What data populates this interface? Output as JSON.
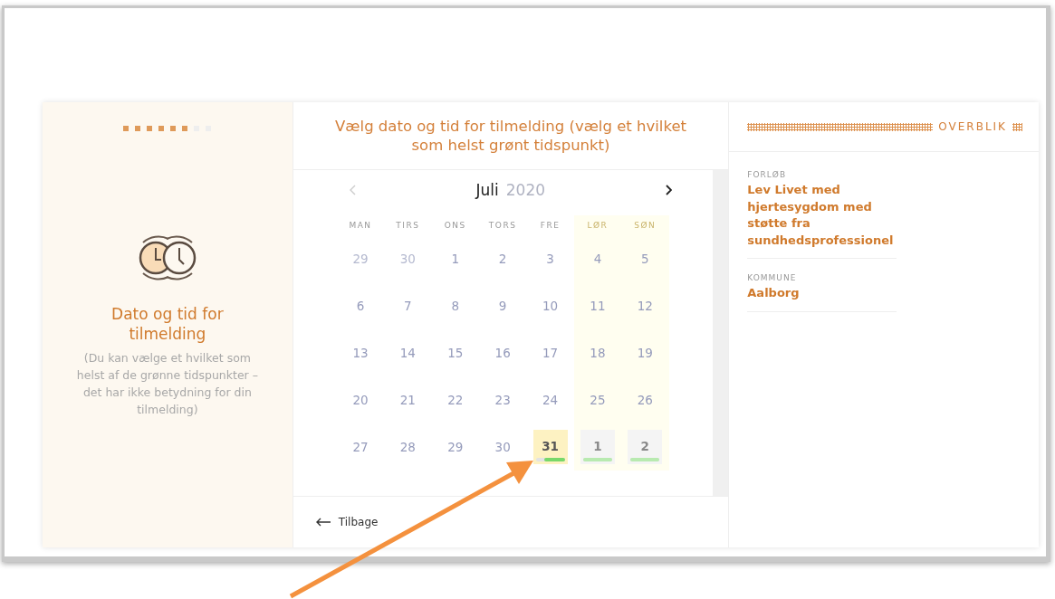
{
  "progress": {
    "steps": [
      {
        "done": true
      },
      {
        "done": true
      },
      {
        "done": true
      },
      {
        "done": true
      },
      {
        "done": true
      },
      {
        "done": true
      },
      {
        "done": false
      },
      {
        "done": false
      }
    ]
  },
  "step": {
    "title": "Dato og tid for tilmelding",
    "description": "(Du kan vælge et hvilket som helst af de grønne tidspunkter – det har ikke betydning for din tilmelding)"
  },
  "calendar": {
    "title": "Vælg dato og tid for tilmelding (vælg et hvilket som helst grønt tidspunkt)",
    "prev_disabled": true,
    "month": "Juli",
    "year": "2020",
    "weekdays": [
      {
        "label": "MAN",
        "weekend": false
      },
      {
        "label": "TIRS",
        "weekend": false
      },
      {
        "label": "ONS",
        "weekend": false
      },
      {
        "label": "TORS",
        "weekend": false
      },
      {
        "label": "FRE",
        "weekend": false
      },
      {
        "label": "LØR",
        "weekend": true
      },
      {
        "label": "SØN",
        "weekend": true
      }
    ],
    "weeks": [
      [
        {
          "label": "29",
          "kind": "other"
        },
        {
          "label": "30",
          "kind": "other"
        },
        {
          "label": "1",
          "kind": "day"
        },
        {
          "label": "2",
          "kind": "day"
        },
        {
          "label": "3",
          "kind": "day"
        },
        {
          "label": "4",
          "kind": "day"
        },
        {
          "label": "5",
          "kind": "day"
        }
      ],
      [
        {
          "label": "6",
          "kind": "day"
        },
        {
          "label": "7",
          "kind": "day"
        },
        {
          "label": "8",
          "kind": "day"
        },
        {
          "label": "9",
          "kind": "day"
        },
        {
          "label": "10",
          "kind": "day"
        },
        {
          "label": "11",
          "kind": "day"
        },
        {
          "label": "12",
          "kind": "day"
        }
      ],
      [
        {
          "label": "13",
          "kind": "day"
        },
        {
          "label": "14",
          "kind": "day"
        },
        {
          "label": "15",
          "kind": "day"
        },
        {
          "label": "16",
          "kind": "day"
        },
        {
          "label": "17",
          "kind": "day"
        },
        {
          "label": "18",
          "kind": "day"
        },
        {
          "label": "19",
          "kind": "day"
        }
      ],
      [
        {
          "label": "20",
          "kind": "day"
        },
        {
          "label": "21",
          "kind": "day"
        },
        {
          "label": "22",
          "kind": "day"
        },
        {
          "label": "23",
          "kind": "day"
        },
        {
          "label": "24",
          "kind": "day"
        },
        {
          "label": "25",
          "kind": "day"
        },
        {
          "label": "26",
          "kind": "day"
        }
      ],
      [
        {
          "label": "27",
          "kind": "day"
        },
        {
          "label": "28",
          "kind": "day"
        },
        {
          "label": "29",
          "kind": "day"
        },
        {
          "label": "30",
          "kind": "day"
        },
        {
          "label": "31",
          "kind": "available",
          "selected": true,
          "level": 0.7
        },
        {
          "label": "1",
          "kind": "available",
          "selected": false,
          "level": 1
        },
        {
          "label": "2",
          "kind": "available",
          "selected": false,
          "level": 1
        }
      ]
    ],
    "back": "Tilbage"
  },
  "overview": {
    "title": "OVERBLIK",
    "items": [
      {
        "label": "FORLØB",
        "value": "Lev Livet med hjertesygdom med støtte fra sundhedsprofessionel"
      },
      {
        "label": "KOMMUNE",
        "value": "Aalborg"
      }
    ]
  }
}
